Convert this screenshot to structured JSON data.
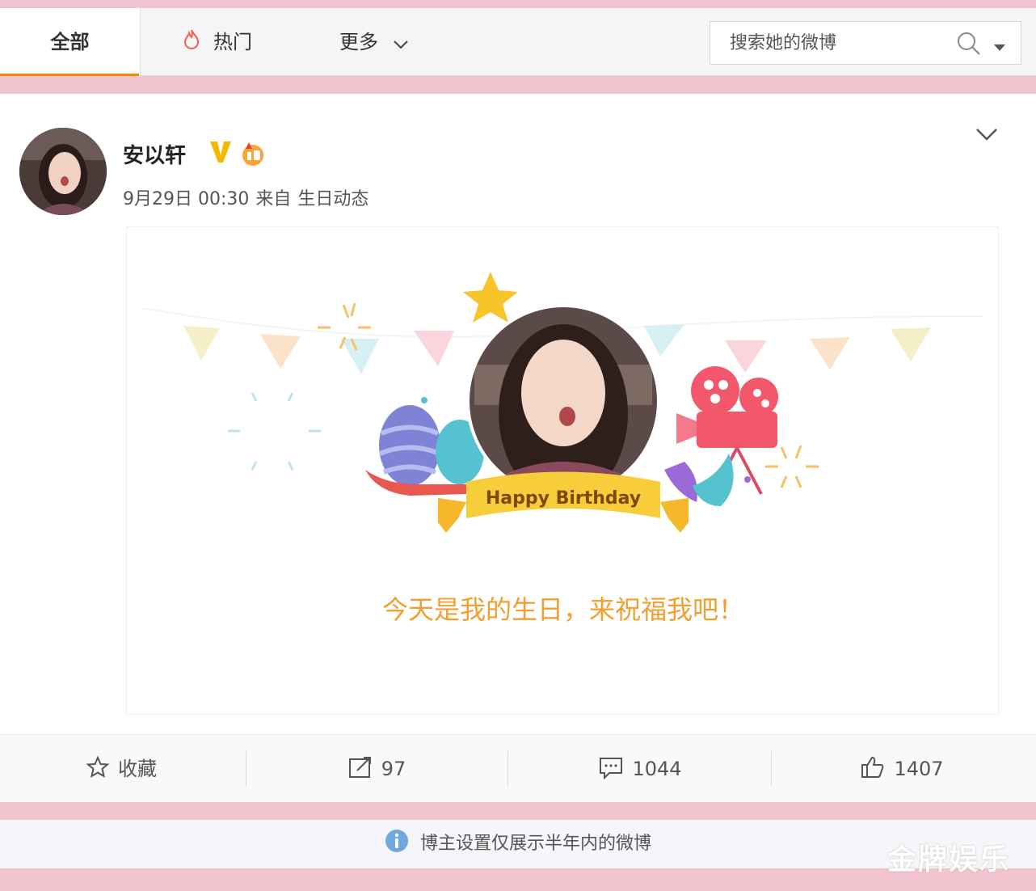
{
  "tabs": {
    "all": "全部",
    "hot": "热门",
    "more": "更多"
  },
  "search": {
    "placeholder": "搜索她的微博"
  },
  "post": {
    "author": "安以轩",
    "date": "9月29日 00:30",
    "source_prefix": "来自",
    "source": "生日动态",
    "card": {
      "banner_text": "Happy Birthday",
      "message": "今天是我的生日，来祝福我吧！"
    }
  },
  "actions": {
    "favorite": "收藏",
    "repost": "97",
    "comment": "1044",
    "like": "1407"
  },
  "notice": "博主设置仅展示半年内的微博",
  "watermark": "金牌娱乐",
  "colors": {
    "accent": "#ff8200",
    "background_pink": "#f2c4d0",
    "verified": "#f5b800",
    "message": "#f0a030"
  },
  "icons": [
    "flame-icon",
    "chevron-down-icon",
    "search-icon",
    "dropdown-caret-icon",
    "verified-icon",
    "level-icon",
    "star-icon",
    "repost-icon",
    "comment-icon",
    "like-icon",
    "info-icon"
  ]
}
